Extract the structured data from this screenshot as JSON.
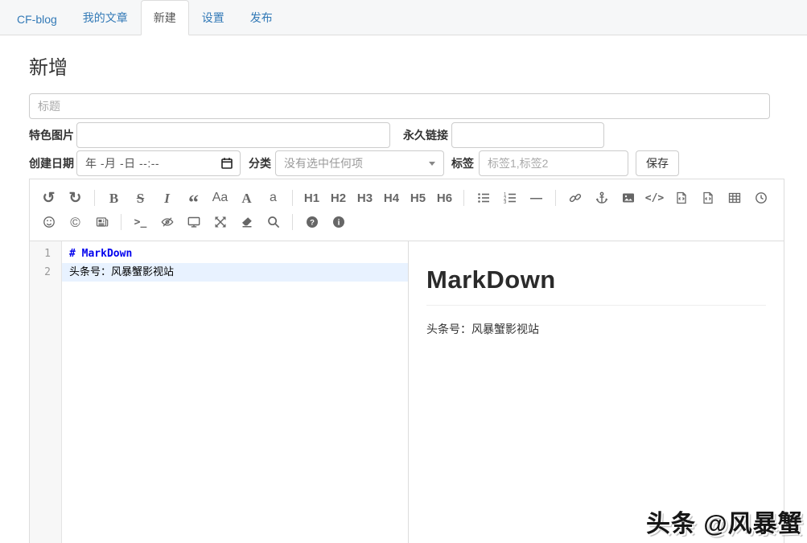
{
  "nav": {
    "tabs": [
      {
        "id": "cf-blog",
        "label": "CF-blog",
        "active": false
      },
      {
        "id": "my-articles",
        "label": "我的文章",
        "active": false
      },
      {
        "id": "new",
        "label": "新建",
        "active": true
      },
      {
        "id": "settings",
        "label": "设置",
        "active": false
      },
      {
        "id": "publish",
        "label": "发布",
        "active": false
      }
    ]
  },
  "page": {
    "title": "新增"
  },
  "form": {
    "title_placeholder": "标题",
    "featured_image_label": "特色图片",
    "permalink_label": "永久链接",
    "created_date_label": "创建日期",
    "date_value": "年 -月 -日 --:--",
    "category_label": "分类",
    "category_value": "没有选中任何项",
    "tags_label": "标签",
    "tags_placeholder": "标签1,标签2",
    "save_label": "保存"
  },
  "toolbar": {
    "row1": [
      {
        "name": "undo",
        "label": "↺",
        "cls": "arrowg"
      },
      {
        "name": "redo",
        "label": "↻",
        "cls": "arrowg"
      },
      {
        "sep": true
      },
      {
        "name": "bold",
        "label": "B",
        "cls": "serifb"
      },
      {
        "name": "strikethrough",
        "label": "S",
        "cls": "serifb strike"
      },
      {
        "name": "italic",
        "label": "I",
        "cls": "serifb ital"
      },
      {
        "name": "quote",
        "label": "“",
        "cls": "quote"
      },
      {
        "name": "uppercase-words",
        "label": "Aa",
        "cls": "aa"
      },
      {
        "name": "uppercase",
        "label": "A",
        "cls": "serifb"
      },
      {
        "name": "lowercase",
        "label": "a",
        "cls": "aa"
      },
      {
        "sep": true
      },
      {
        "name": "h1",
        "label": "H1",
        "cls": "hx"
      },
      {
        "name": "h2",
        "label": "H2",
        "cls": "hx"
      },
      {
        "name": "h3",
        "label": "H3",
        "cls": "hx"
      },
      {
        "name": "h4",
        "label": "H4",
        "cls": "hx"
      },
      {
        "name": "h5",
        "label": "H5",
        "cls": "hx"
      },
      {
        "name": "h6",
        "label": "H6",
        "cls": "hx"
      },
      {
        "sep": true
      },
      {
        "name": "list-ul",
        "icon": "list-ul"
      },
      {
        "name": "list-ol",
        "icon": "list-ol"
      },
      {
        "name": "hr",
        "label": "—",
        "cls": "hx"
      },
      {
        "sep": true
      },
      {
        "name": "link",
        "icon": "link"
      },
      {
        "name": "reference-link",
        "icon": "anchor"
      },
      {
        "name": "image",
        "icon": "image"
      },
      {
        "name": "code",
        "label": "</>",
        "cls": "mono"
      },
      {
        "name": "preformatted-text",
        "icon": "file-code"
      },
      {
        "name": "code-block",
        "icon": "file-code"
      },
      {
        "name": "table",
        "icon": "table"
      },
      {
        "name": "datetime",
        "icon": "clock"
      }
    ],
    "row2": [
      {
        "name": "emoji",
        "icon": "emoji"
      },
      {
        "name": "html-entities",
        "label": "©",
        "cls": "copy"
      },
      {
        "name": "pagebreak",
        "icon": "newspaper"
      },
      {
        "sep": true
      },
      {
        "name": "goto-line",
        "label": ">_",
        "cls": "mono"
      },
      {
        "name": "watch",
        "icon": "eye-slash"
      },
      {
        "name": "preview",
        "icon": "monitor"
      },
      {
        "name": "fullscreen",
        "icon": "arrows"
      },
      {
        "name": "clear",
        "icon": "eraser"
      },
      {
        "name": "search",
        "icon": "search"
      },
      {
        "sep": true
      },
      {
        "name": "help",
        "icon": "help"
      },
      {
        "name": "info",
        "icon": "info"
      }
    ]
  },
  "editor": {
    "lines": [
      {
        "number": "1",
        "text": "# MarkDown",
        "style": "md-header",
        "active": false
      },
      {
        "number": "2",
        "text": "头条号：风暴蟹影视站",
        "style": "",
        "active": true
      }
    ]
  },
  "preview": {
    "heading": "MarkDown",
    "paragraph": "头条号：风暴蟹影视站"
  },
  "watermark": {
    "text": "头条 @风暴蟹"
  },
  "colors": {
    "accent": "#337ab7",
    "md_header_blue": "#0000ee",
    "active_line_bg": "#e8f2ff",
    "toolbar_icon": "#666666",
    "border": "#dddddd"
  }
}
